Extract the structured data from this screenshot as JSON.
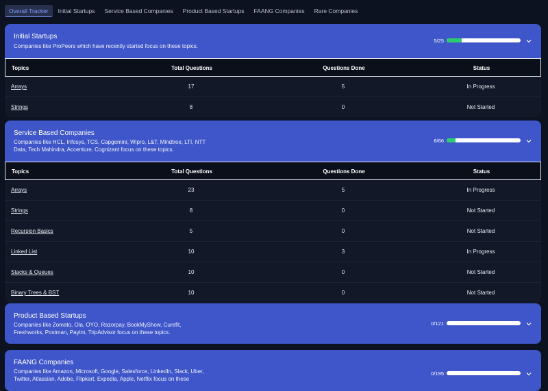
{
  "tabs": [
    "Overall Tracker",
    "Initial Startups",
    "Service Based Companies",
    "Product Based Startups",
    "FAANG Companies",
    "Rare Companies"
  ],
  "active_tab": 0,
  "columns": [
    "Topics",
    "Total Questions",
    "Questions Done",
    "Status"
  ],
  "colors": {
    "header": "#3e56c9",
    "progress_fill": "#2ecc71",
    "active_tab": "#7f9dff"
  },
  "sections": [
    {
      "title": "Initial Startups",
      "description": "Companies like ProPeers which have recently started focus on these topics.",
      "progress_text": "5/25",
      "progress_fraction": 0.2,
      "rows": [
        {
          "topic": "Arrays",
          "total": "17",
          "done": "5",
          "status": "In Progress"
        },
        {
          "topic": "Strings",
          "total": "8",
          "done": "0",
          "status": "Not Started"
        }
      ]
    },
    {
      "title": "Service Based Companies",
      "description": "Companies like HCL, Infosys, TCS, Capgemini, Wipro, L&T, Mindtree, LTI, NTT Data, Tech Mahindra, Accenture, Cognizant focus on these topics.",
      "progress_text": "8/66",
      "progress_fraction": 0.121,
      "rows": [
        {
          "topic": "Arrays",
          "total": "23",
          "done": "5",
          "status": "In Progress"
        },
        {
          "topic": "Strings",
          "total": "8",
          "done": "0",
          "status": "Not Started"
        },
        {
          "topic": "Recursion Basics",
          "total": "5",
          "done": "0",
          "status": "Not Started"
        },
        {
          "topic": "Linked List",
          "total": "10",
          "done": "3",
          "status": "In Progress"
        },
        {
          "topic": "Stacks & Queues",
          "total": "10",
          "done": "0",
          "status": "Not Started"
        },
        {
          "topic": "Binary Trees & BST",
          "total": "10",
          "done": "0",
          "status": "Not Started"
        }
      ]
    },
    {
      "title": "Product Based Startups",
      "description": "Companies like Zomato, Ola, OYO, Razorpay, BookMyShow, Curefit, Freshworks, Postman, Paytm, TripAdvisor focus on these topics.",
      "progress_text": "0/121",
      "progress_fraction": 0,
      "rows": []
    },
    {
      "title": "FAANG Companies",
      "description": "Companies like Amazon, Microsoft, Google, Salesforce, LinkedIn, Slack, Uber, Twitter, Atlassian, Adobe, Flipkart, Expedia, Apple, Netflix focus on these",
      "progress_text": "0/195",
      "progress_fraction": 0,
      "rows": []
    }
  ]
}
